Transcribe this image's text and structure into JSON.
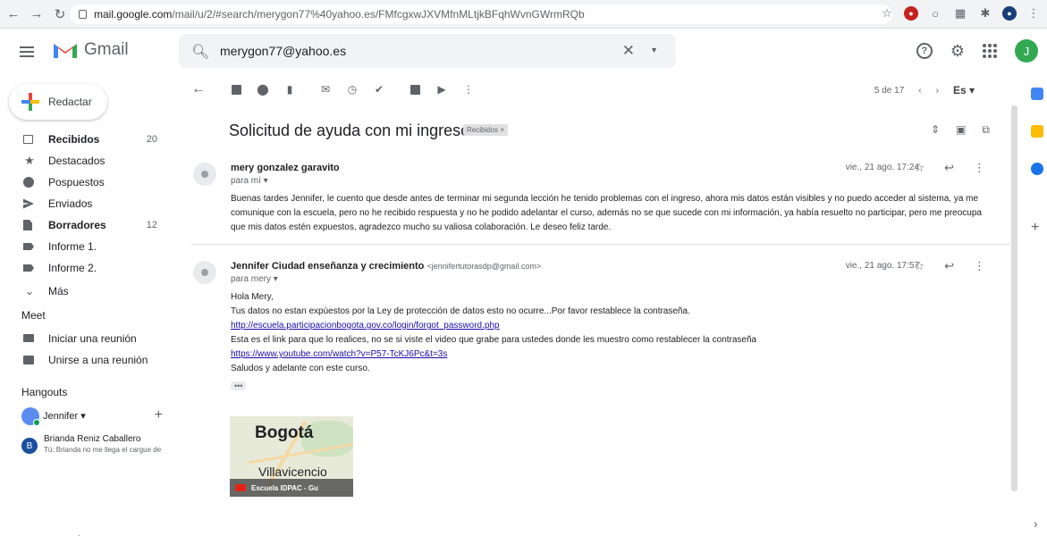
{
  "browser": {
    "url_host": "mail.google.com",
    "url_path": "/mail/u/2/#search/merygon77%40yahoo.es/FMfcgxwJXVMfnMLtjkBFqhWvnGWrmRQb"
  },
  "header": {
    "app_name": "Gmail",
    "search_query": "merygon77@yahoo.es",
    "avatar_letter": "J"
  },
  "sidebar": {
    "compose_label": "Redactar",
    "items": [
      {
        "label": "Recibidos",
        "count": "20"
      },
      {
        "label": "Destacados",
        "count": ""
      },
      {
        "label": "Pospuestos",
        "count": ""
      },
      {
        "label": "Enviados",
        "count": ""
      },
      {
        "label": "Borradores",
        "count": "12"
      },
      {
        "label": "Informe 1.",
        "count": ""
      },
      {
        "label": "Informe 2.",
        "count": ""
      },
      {
        "label": "Más",
        "count": ""
      }
    ],
    "meet_title": "Meet",
    "meet_items": [
      "Iniciar una reunión",
      "Unirse a una reunión"
    ],
    "hangouts_title": "Hangouts",
    "hangouts_user": "Jennifer",
    "contact": {
      "initial": "B",
      "name": "Brianda Reniz Caballero",
      "snippet": "Tú: Brianda no me llega el cargue de"
    }
  },
  "toolbar": {
    "pager": "5 de 17",
    "lang": "Es"
  },
  "thread": {
    "subject": "Solicitud de ayuda con mi ingreso",
    "tag": "Recibidos ×",
    "messages": [
      {
        "sender": "mery gonzalez garavito",
        "email": "",
        "to": "para mí ▾",
        "date": "vie., 21 ago. 17:24",
        "body_lines": [
          "Buenas tardes Jennifer, le cuento que desde antes de terminar mi segunda lección he tenido problemas con el ingreso, ahora mis datos están visibles y no puedo acceder al sistema, ya me",
          "comunique con la escuela, pero no he  recibido respuesta y no he podido adelantar el curso, además no se que sucede con mi información, ya había resuelto no participar,  pero me preocupa",
          "que mis datos estén expuestos, agradezco mucho su valiosa colaboración. Le deseo feliz tarde."
        ]
      },
      {
        "sender": "Jennifer Ciudad enseñanza y crecimiento",
        "email": "<jennifertutorasdp@gmail.com>",
        "to": "para mery ▾",
        "date": "vie., 21 ago. 17:57",
        "line1": "Hola Mery,",
        "line2": "Tus datos no estan expùestos por la Ley de protección de datos esto no ocurre...Por favor restablece la contraseña.",
        "link1": "http://escuela.participacionbogota.gov.co/login/forgot_password.php",
        "line3": "Esta es el link para que lo realices, no se si viste el video que grabe para ustedes donde les muestro como restablecer la contraseña",
        "link2": "https://www.youtube.com/watch?v=P57-TcKJ6Pc&t=3s",
        "line4": "Saludos y adelante con este curso.",
        "dots": "•••"
      }
    ],
    "video": {
      "city1": "Bogotá",
      "city2": "Villavicencio",
      "caption": "Escuela IDPAC - Gu"
    }
  },
  "colors": {
    "gmail_red": "#ea4335",
    "link": "#1a0dab",
    "avatar_green": "#33a852"
  }
}
